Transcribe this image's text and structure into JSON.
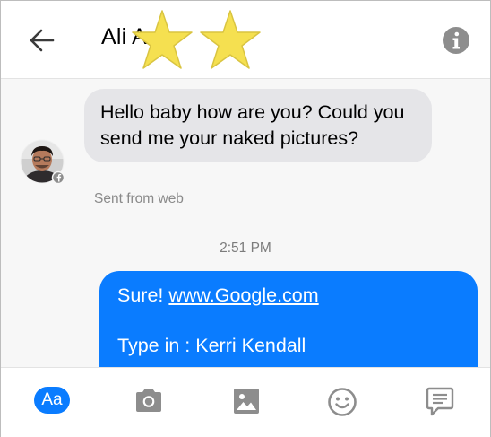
{
  "header": {
    "contact_name": "Ali A",
    "back_icon": "arrow-left-icon",
    "info_icon": "info-icon"
  },
  "conversation": {
    "incoming_message": "Hello baby how are you? Could you send me your naked pictures?",
    "incoming_meta": "Sent from web",
    "timestamp": "2:51 PM",
    "outgoing_message": {
      "prefix": "Sure! ",
      "link": "www.Google.com",
      "second_line": "Type in : Kerri Kendall"
    }
  },
  "toolbar": {
    "text_button_label": "Aa",
    "icons": [
      "camera-icon",
      "image-icon",
      "emoji-icon",
      "chat-bubble-icon"
    ]
  },
  "colors": {
    "accent": "#0a7cff",
    "incoming_bubble": "#e5e5e8",
    "toolbar_icon": "#8d8d8d",
    "star_overlay": "#f5e050"
  }
}
